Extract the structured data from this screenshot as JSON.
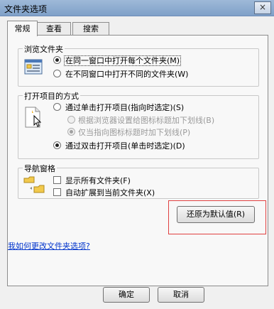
{
  "window": {
    "title": "文件夹选项",
    "close_glyph": "×"
  },
  "tabs": [
    {
      "label": "常规",
      "active": true
    },
    {
      "label": "查看",
      "active": false
    },
    {
      "label": "搜索",
      "active": false
    }
  ],
  "browse": {
    "title": "浏览文件夹",
    "option_same": "在同一窗口中打开每个文件夹(M)",
    "option_diff": "在不同窗口中打开不同的文件夹(W)",
    "selected": "same"
  },
  "click_items": {
    "title": "打开项目的方式",
    "single": "通过单击打开项目(指向时选定)(S)",
    "sub_browser": "根据浏览器设置给图标标题加下划线(B)",
    "sub_point": "仅当指向图标标题时加下划线(P)",
    "double": "通过双击打开项目(单击时选定)(D)",
    "selected": "double"
  },
  "nav_pane": {
    "title": "导航窗格",
    "show_all": "显示所有文件夹(F)",
    "auto_expand": "自动扩展到当前文件夹(X)"
  },
  "restore_button": "还原为默认值(R)",
  "help_link": "我如何更改文件夹选项?",
  "buttons": {
    "ok": "确定",
    "cancel": "取消"
  },
  "colors": {
    "highlight": "#e04040",
    "link": "#0033cc"
  }
}
